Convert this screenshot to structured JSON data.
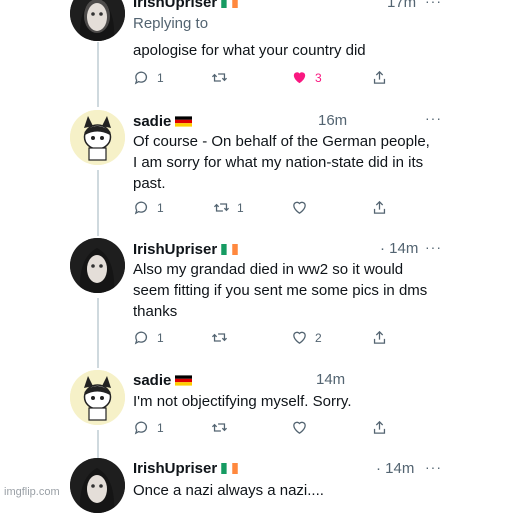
{
  "tweets": [
    {
      "name": "IrishUpriser",
      "time": "17m",
      "replying": "Replying to",
      "text": "apologise for what your country did",
      "stats": {
        "replies": "1",
        "retweets": "",
        "likes": "3",
        "liked": true
      }
    },
    {
      "name": "sadie",
      "time": "16m",
      "text": "Of course - On behalf of the German people, I am sorry for what my nation-state did in its past.",
      "stats": {
        "replies": "1",
        "retweets": "1",
        "likes": ""
      }
    },
    {
      "name": "IrishUpriser",
      "time": "14m",
      "text": "Also my grandad died in ww2 so it would seem fitting if you sent me some pics in dms thanks",
      "stats": {
        "replies": "1",
        "retweets": "",
        "likes": "2"
      }
    },
    {
      "name": "sadie",
      "time": "14m",
      "text": "I'm not objectifying myself. Sorry.",
      "stats": {
        "replies": "1",
        "retweets": "",
        "likes": ""
      }
    },
    {
      "name": "IrishUpriser",
      "time": "· 14m",
      "text": "Once a nazi always a nazi...."
    }
  ],
  "more_label": "···",
  "watermark": "imgflip.com",
  "colors": {
    "like_active": "#f91880",
    "icon_gray": "#536471",
    "thread_line": "#cfd9de"
  },
  "flags": {
    "irish": "flag-ireland",
    "german": "flag-germany"
  }
}
